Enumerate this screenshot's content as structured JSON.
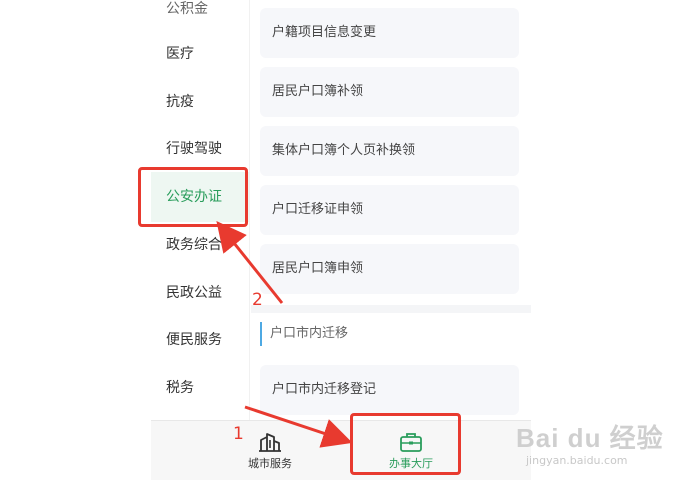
{
  "sidebar": {
    "items": [
      {
        "label": "公积金"
      },
      {
        "label": "医疗"
      },
      {
        "label": "抗疫"
      },
      {
        "label": "行驶驾驶"
      },
      {
        "label": "公安办证"
      },
      {
        "label": "政务综合"
      },
      {
        "label": "民政公益"
      },
      {
        "label": "便民服务"
      },
      {
        "label": "税务"
      }
    ],
    "active_index": 4
  },
  "content": {
    "cards_top": [
      {
        "label": "户籍项目信息变更"
      },
      {
        "label": "居民户口簿补领"
      },
      {
        "label": "集体户口簿个人页补换领"
      },
      {
        "label": "户口迁移证申领"
      },
      {
        "label": "居民户口簿申领"
      }
    ],
    "section_title": "户口市内迁移",
    "cards_bottom": [
      {
        "label": "户口市内迁移登记"
      }
    ]
  },
  "tabbar": {
    "tabs": [
      {
        "label": "城市服务",
        "icon": "city-buildings-icon"
      },
      {
        "label": "办事大厅",
        "icon": "briefcase-icon"
      }
    ],
    "active_index": 1
  },
  "annotations": {
    "step1": "1",
    "step2": "2",
    "color": "#e83a2f"
  },
  "watermark": {
    "logo": "Bai du 经验",
    "url": "jingyan.baidu.com"
  },
  "colors": {
    "accent_green": "#2a9d5c",
    "active_bg": "#eef7f2",
    "annotation_red": "#e83a2f"
  }
}
